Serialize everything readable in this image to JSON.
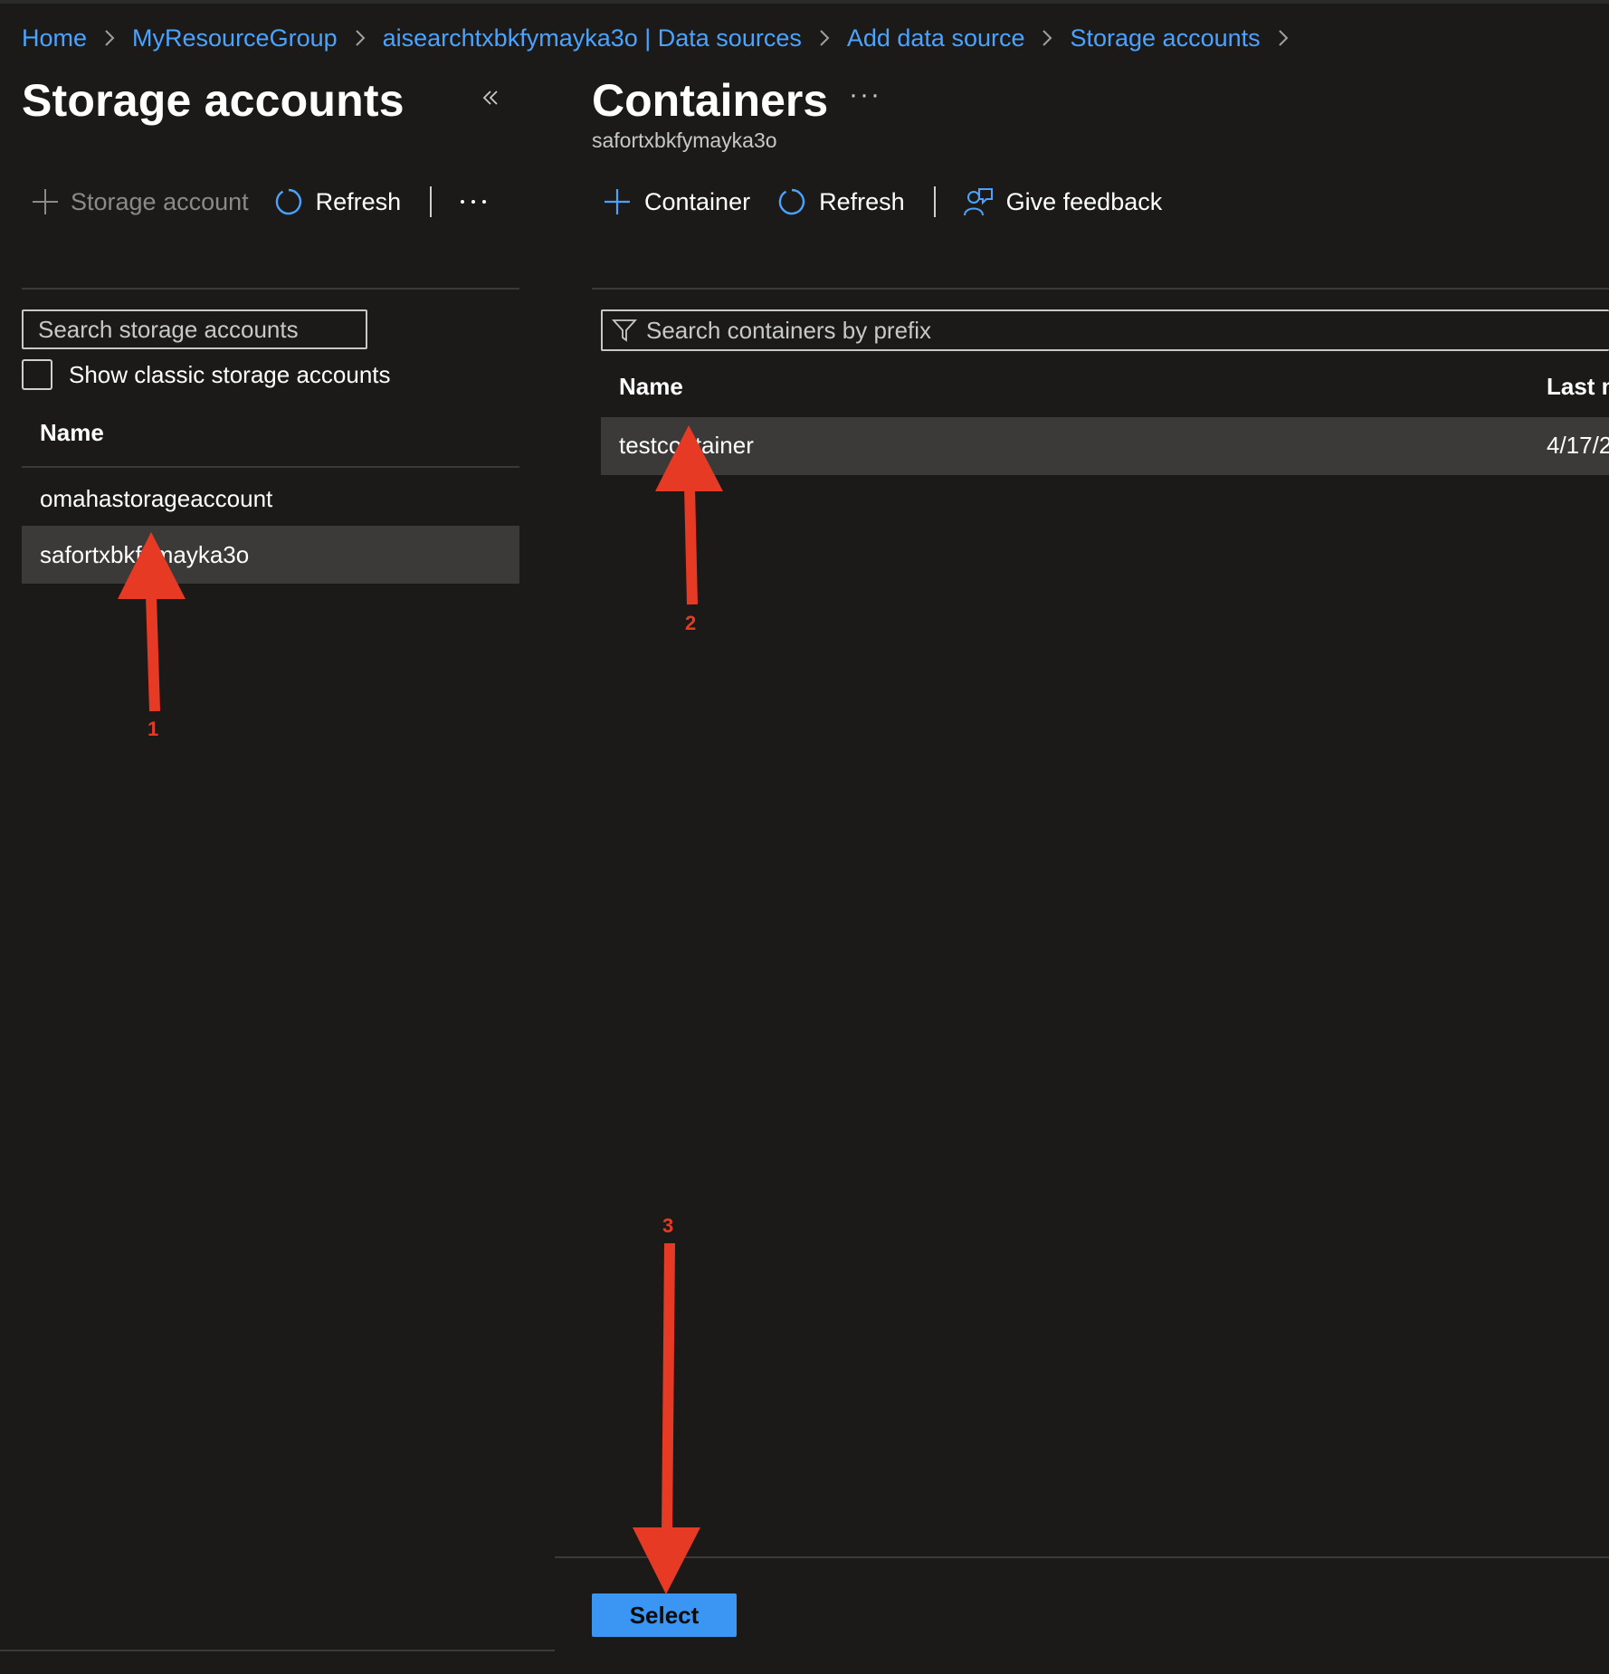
{
  "breadcrumb": [
    "Home",
    "MyResourceGroup",
    "aisearchtxbkfymayka3o | Data sources",
    "Add data source",
    "Storage accounts"
  ],
  "left_panel": {
    "title": "Storage accounts",
    "toolbar": {
      "add_label": "Storage account",
      "refresh_label": "Refresh"
    },
    "search_placeholder": "Search storage accounts",
    "checkbox_label": "Show classic storage accounts",
    "column_name": "Name",
    "rows": [
      "omahastorageaccount",
      "safortxbkfymayka3o"
    ]
  },
  "right_panel": {
    "title": "Containers",
    "subtitle": "safortxbkfymayka3o",
    "toolbar": {
      "add_label": "Container",
      "refresh_label": "Refresh",
      "feedback_label": "Give feedback"
    },
    "search_placeholder": "Search containers by prefix",
    "columns": [
      "Name",
      "Last m"
    ],
    "rows": [
      {
        "name": "testcontainer",
        "last_modified": "4/17/2"
      }
    ],
    "select_label": "Select"
  },
  "annotations": {
    "labels": [
      "1",
      "2",
      "3"
    ],
    "color": "#e63a25"
  },
  "colors": {
    "accent": "#4aa3ff",
    "background": "#1b1a19",
    "selected_row": "#3b3a39",
    "primary_button": "#3a96f2"
  }
}
